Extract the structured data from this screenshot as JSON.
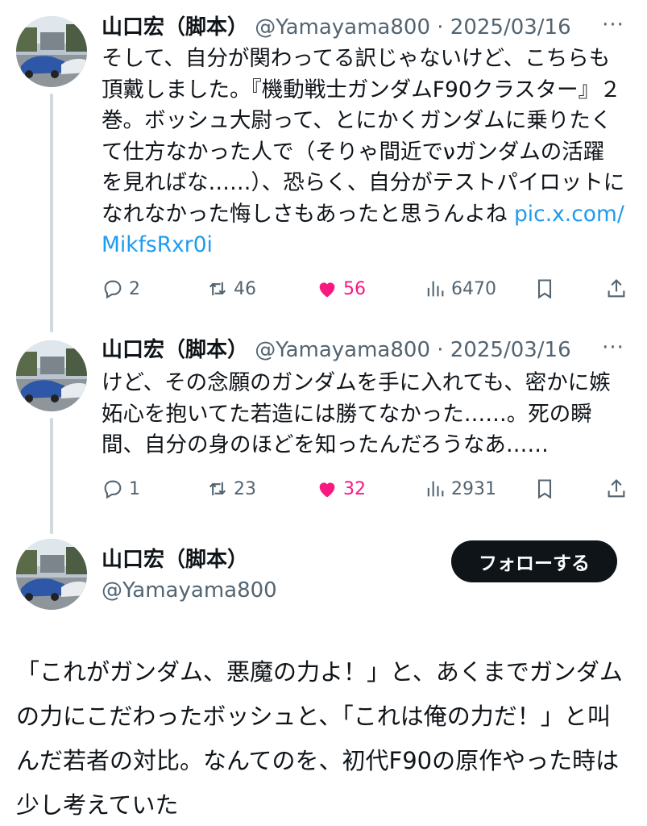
{
  "author": {
    "name": "山口宏（脚本）",
    "handle": "@Yamayama800",
    "avatar_icon": "avatar-cars-photo"
  },
  "colors": {
    "text": "#0f1419",
    "muted": "#536471",
    "link": "#1d9bf0",
    "like": "#f91880",
    "thread_line": "#cfd9de"
  },
  "tweets": [
    {
      "name": "山口宏（脚本）",
      "handle": "@Yamayama800",
      "separator": "·",
      "date": "2025/03/16",
      "more_icon": "more-dots-icon",
      "text": "そして、自分が関わってる訳じゃないけど、こちらも頂戴しました。『機動戦士ガンダムF90クラスター』２巻。ボッシュ大尉って、とにかくガンダムに乗りたくて仕方なかった人で（そりゃ間近でνガンダムの活躍を見ればな……）、恐らく、自分がテストパイロットになれなかった悔しさもあったと思うんよね ",
      "link": "pic.x.com/MikfsRxr0i",
      "replies": "2",
      "reposts": "46",
      "likes": "56",
      "views": "6470"
    },
    {
      "name": "山口宏（脚本）",
      "handle": "@Yamayama800",
      "separator": "·",
      "date": "2025/03/16",
      "more_icon": "more-dots-icon",
      "text": "けど、その念願のガンダムを手に入れても、密かに嫉妬心を抱いてた若造には勝てなかった……。死の瞬間、自分の身のほどを知ったんだろうなあ……",
      "replies": "1",
      "reposts": "23",
      "likes": "32",
      "views": "2931"
    }
  ],
  "main": {
    "name": "山口宏（脚本）",
    "handle": "@Yamayama800",
    "follow_label": "フォローする",
    "text": "「これがガンダム、悪魔の力よ！」と、あくまでガンダムの力にこだわったボッシュと、「これは俺の力だ！」と叫んだ若者の対比。なんてのを、初代F90の原作やった時は少し考えていた"
  }
}
